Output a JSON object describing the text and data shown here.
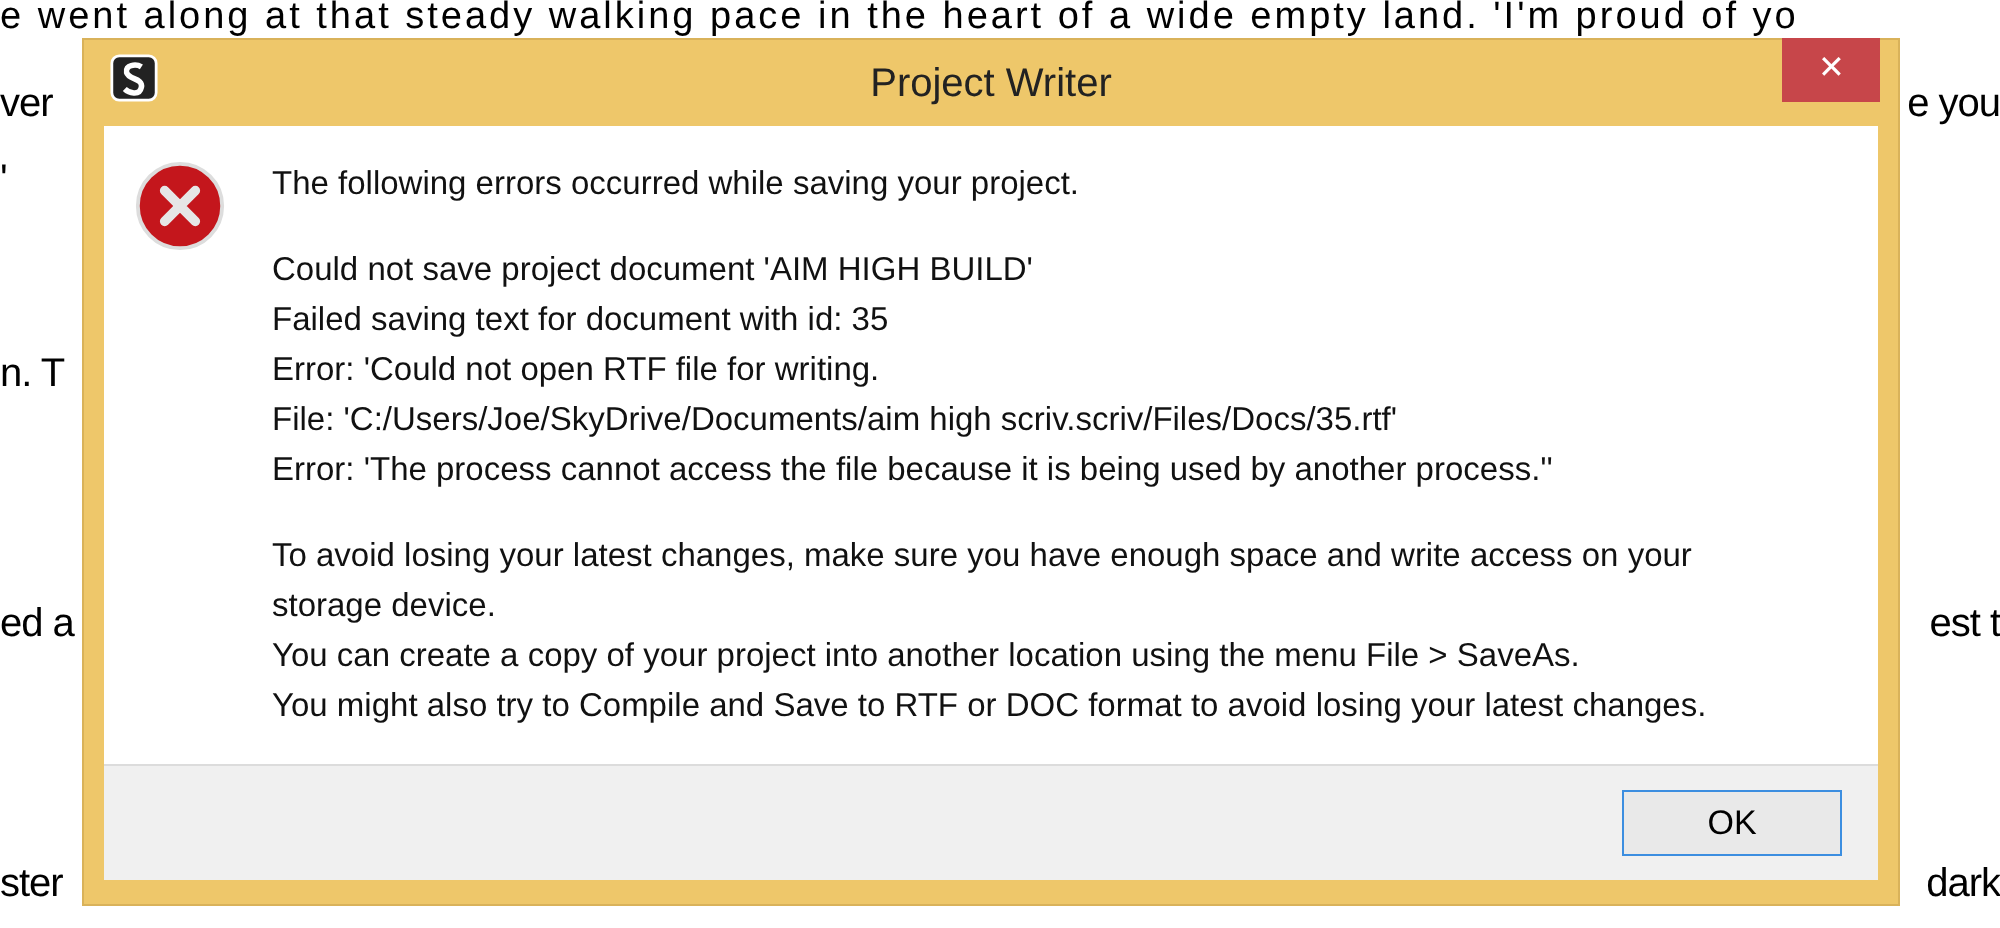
{
  "background_document": {
    "lines": [
      {
        "left": "e went along at that steady walking pace in the heart of a wide empty land. 'I'm proud of yo"
      },
      {
        "left": "ver",
        "right": "e you"
      },
      {
        "left": "'"
      },
      {
        "left": "n. T"
      },
      {
        "left": "ed a",
        "right": "est t"
      },
      {
        "left": "ster",
        "right": "dark"
      }
    ]
  },
  "dialog": {
    "title": "Project Writer",
    "close": "✕",
    "messages": [
      [
        "The following errors occurred while saving your project."
      ],
      [
        "Could not save project document 'AIM HIGH BUILD'",
        "Failed saving text for document with id: 35",
        "Error: 'Could not open RTF file for writing.",
        "File: 'C:/Users/Joe/SkyDrive/Documents/aim high scriv.scriv/Files/Docs/35.rtf'",
        "Error: 'The process cannot access the file because it is being used by another process.''"
      ],
      [
        "To avoid losing your latest changes, make sure you have enough space and write access on your storage device.",
        "You can create a copy of your project into another location using the menu File > SaveAs.",
        "You might also try to Compile and Save to RTF or DOC format to avoid losing your latest changes."
      ]
    ],
    "buttons": [
      "OK"
    ]
  }
}
